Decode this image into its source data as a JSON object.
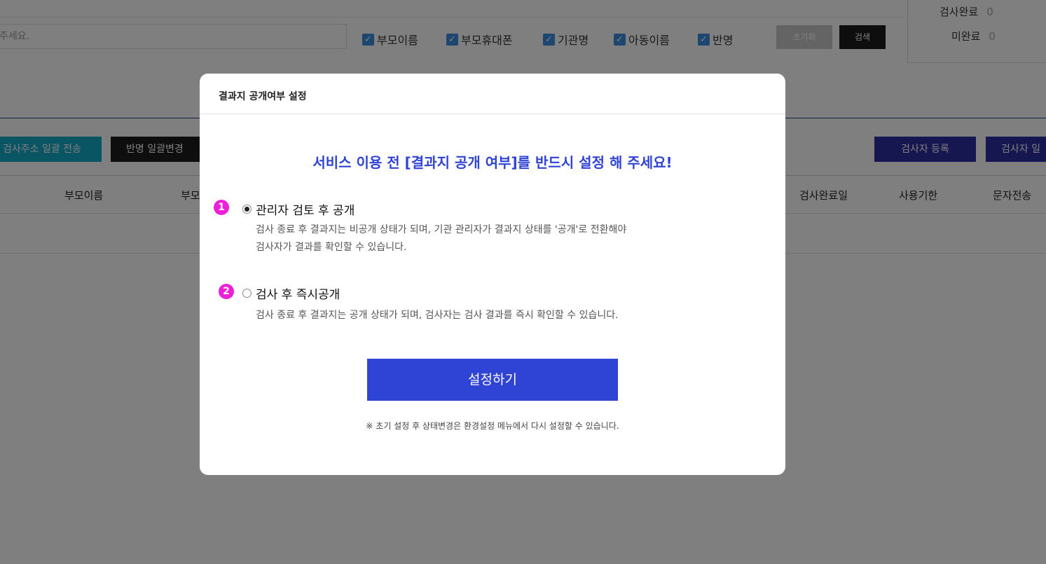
{
  "background": {
    "search_placeholder_tail": "주세요.",
    "filters": [
      "부모이름",
      "부모휴대폰",
      "기관명",
      "아동이름",
      "반명"
    ],
    "reset_label": "초기화",
    "search_label": "검색",
    "stats": [
      {
        "label": "검사완료",
        "value": "0"
      },
      {
        "label": "미완료",
        "value": "0"
      }
    ],
    "action_buttons": {
      "send_address": "검사주소 일괄 전송",
      "bulk_class_change": "반명 일괄변경",
      "register_tester": "검사자 등록",
      "tester_bulk": "검사자 일"
    },
    "columns": [
      "부모이름",
      "부모",
      "검사완료일",
      "사용기한",
      "문자전송"
    ]
  },
  "modal": {
    "title": "결과지 공개여부 설정",
    "headline": "서비스 이용 전 [결과지 공개 여부]를 반드시 설정 해 주세요!",
    "options": [
      {
        "badge": "1",
        "label": "관리자 검토 후 공개",
        "checked": true,
        "desc_line1": "검사 종료 후 결과지는 비공개 상태가 되며, 기관 관리자가 결과지 상태를 '공개'로 전환해야",
        "desc_line2": "검사자가 결과를 확인할 수 있습니다."
      },
      {
        "badge": "2",
        "label": "검사 후 즉시공개",
        "checked": false,
        "desc_line1": "검사 종료 후 결과지는 공개 상태가 되며, 검사자는 검사 결과를 즉시 확인할 수 있습니다."
      }
    ],
    "submit_label": "설정하기",
    "note": "※ 초기 설정 후 상태변경은 환경설정 메뉴에서 다시 설정할 수 있습니다."
  },
  "colors": {
    "accent_blue": "#2f43d4",
    "badge_pink": "#ee1fd9",
    "teal": "#13aac8",
    "navy": "#2c2fa3"
  }
}
